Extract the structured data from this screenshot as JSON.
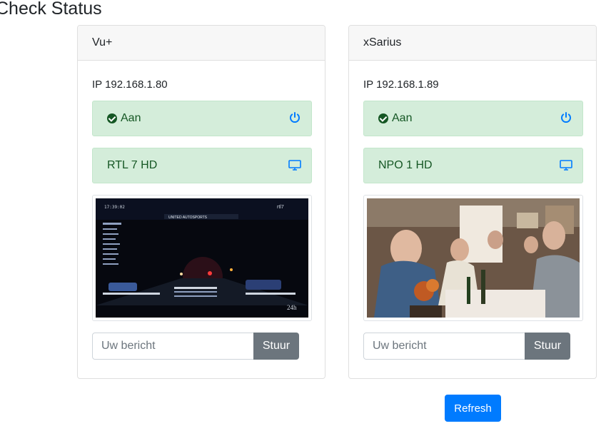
{
  "page": {
    "title": "Check Status"
  },
  "devices": [
    {
      "name": "Vu+",
      "ip": "IP 192.168.1.80",
      "status": "Aan",
      "channel": "RTL 7 HD",
      "message_placeholder": "Uw bericht",
      "send_label": "Stuur",
      "screenshot": {
        "description_icon": "tv-snapshot",
        "overlay_clock": "17:39:02",
        "overlay_logo": "rtl7",
        "overlay_title": "UNITED AUTOSPORTS",
        "overlay_corner": "24h"
      }
    },
    {
      "name": "xSarius",
      "ip": "IP 192.168.1.89",
      "status": "Aan",
      "channel": "NPO 1 HD",
      "message_placeholder": "Uw bericht",
      "send_label": "Stuur",
      "screenshot": {
        "description_icon": "tv-snapshot"
      }
    }
  ],
  "actions": {
    "refresh_label": "Refresh"
  },
  "colors": {
    "success_bg": "#d4edda",
    "success_text": "#155724",
    "icon_blue": "#007bff",
    "send_gray": "#6c757d",
    "refresh_blue": "#007bff"
  },
  "icons": {
    "status": "check-circle-icon",
    "power": "power-icon",
    "channel": "monitor-icon"
  }
}
